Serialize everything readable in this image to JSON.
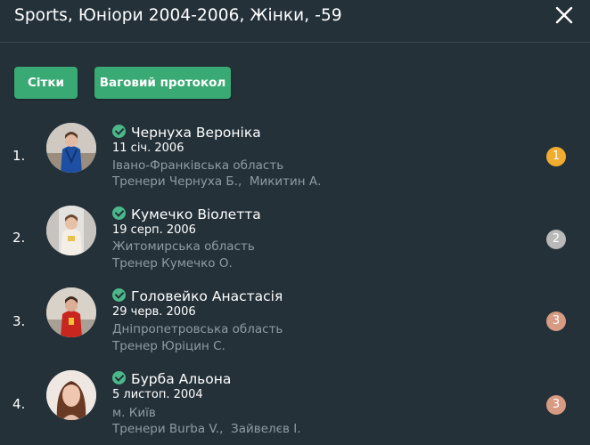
{
  "header": {
    "title": "Sports, Юніори 2004-2006, Жінки, -59",
    "close_icon": "close-icon"
  },
  "actions": {
    "grids_label": "Сітки",
    "weigh_label": "Ваговий протокол"
  },
  "colors": {
    "background": "#243139",
    "accent_green": "#3aaa74",
    "verified": "#4bb88a",
    "gold": "#f0ad30",
    "silver": "#b9b9b9",
    "bronze": "#d79a82",
    "muted_text": "#8f9ca4"
  },
  "athletes": [
    {
      "place": "1.",
      "name": "Чернуха Вероніка",
      "dob": "11 січ. 2006",
      "region": "Івано-Франківська область",
      "coach": "Тренери Чернуха Б.,  Микитин А.",
      "medal": "1",
      "medal_color": "#f0ad30",
      "verified_icon": "check-circle-icon"
    },
    {
      "place": "2.",
      "name": "Кумечко Віолетта",
      "dob": "19 серп. 2006",
      "region": "Житомирська область",
      "coach": "Тренер Кумечко О.",
      "medal": "2",
      "medal_color": "#b9b9b9",
      "verified_icon": "check-circle-icon"
    },
    {
      "place": "3.",
      "name": "Головейко Анастасія",
      "dob": "29 черв. 2006",
      "region": "Дніпропетровська область",
      "coach": "Тренер Юріцин С.",
      "medal": "3",
      "medal_color": "#d79a82",
      "verified_icon": "check-circle-icon"
    },
    {
      "place": "4.",
      "name": "Бурба Альона",
      "dob": "5 листоп. 2004",
      "region": "м. Київ",
      "coach": "Тренери Burba V.,  Зайвелєв І.",
      "medal": "3",
      "medal_color": "#d79a82",
      "verified_icon": "check-circle-icon"
    }
  ]
}
